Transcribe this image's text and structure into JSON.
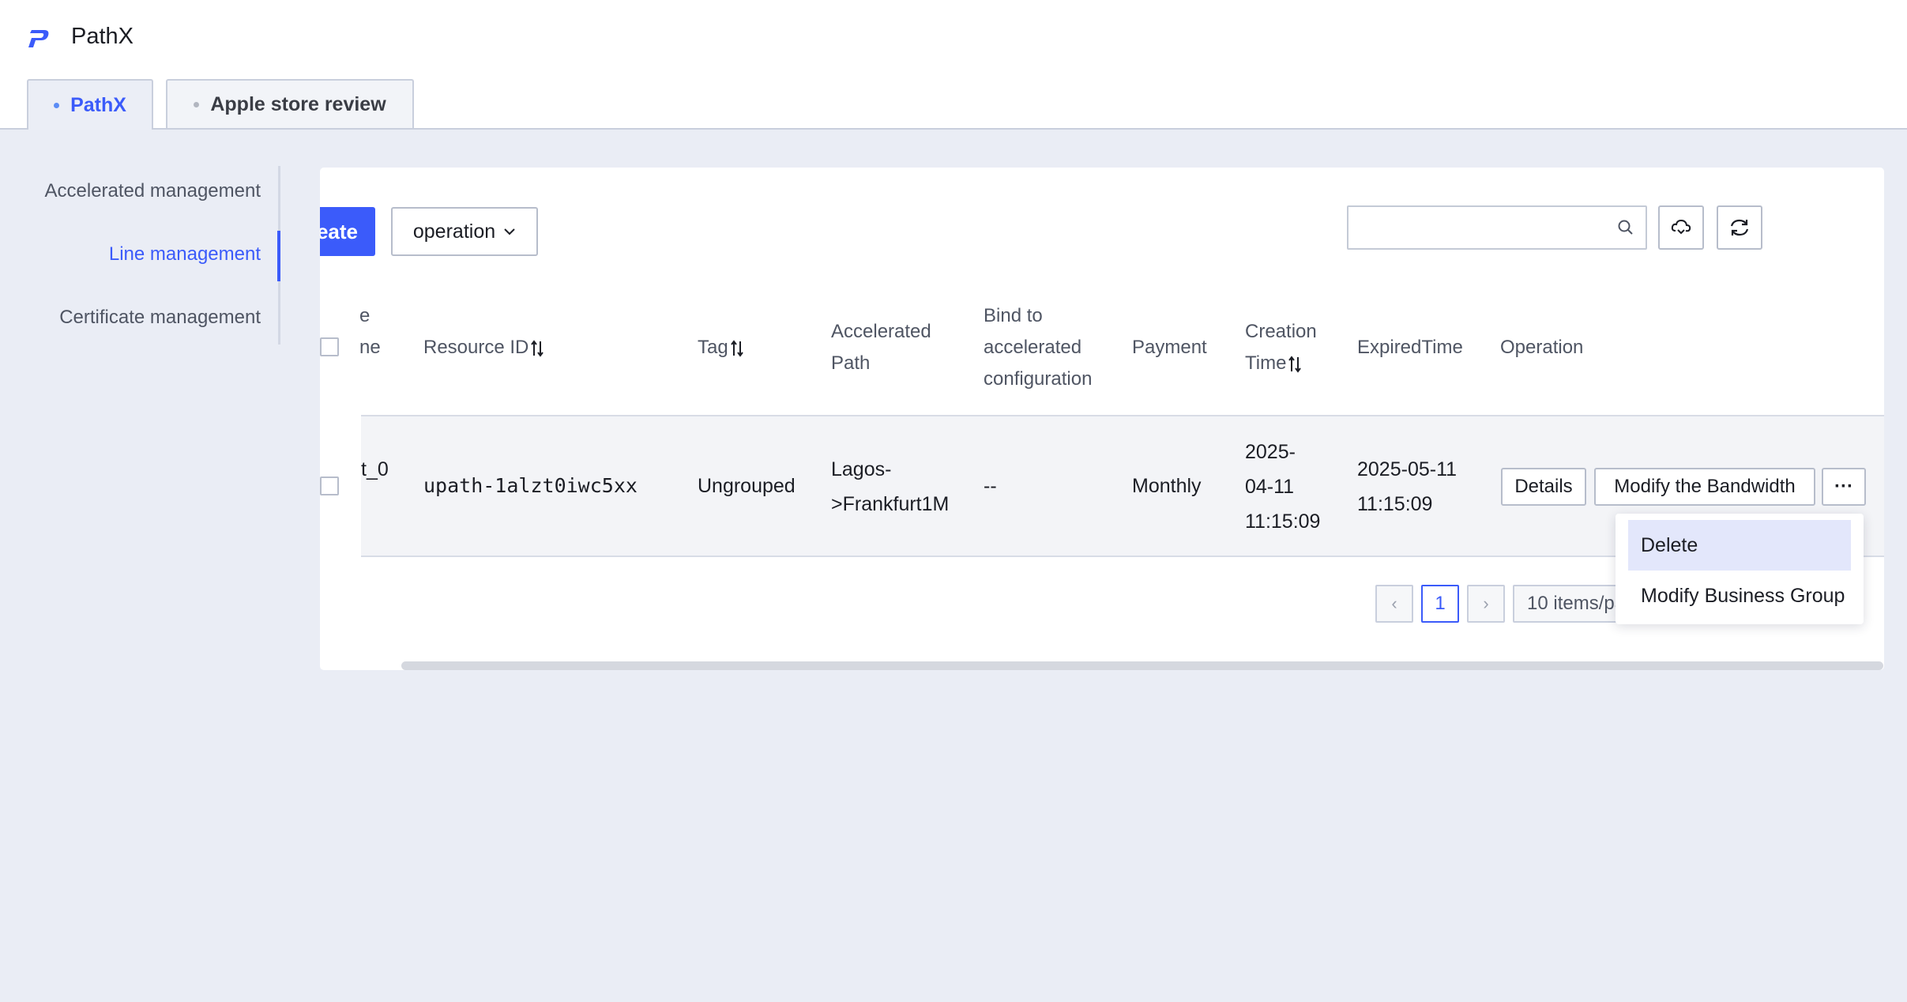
{
  "app": {
    "title": "PathX",
    "accent_color": "#3b5bfa",
    "logo_icon": "pathx-logo-icon"
  },
  "tabs": [
    {
      "label": "PathX",
      "active": true
    },
    {
      "label": "Apple store review",
      "active": false
    }
  ],
  "sidebar": {
    "items": [
      {
        "label": "Accelerated management",
        "active": false
      },
      {
        "label": "Line management",
        "active": true
      },
      {
        "label": "Certificate management",
        "active": false
      }
    ]
  },
  "toolbar": {
    "create_label": "eate",
    "operation_label": "operation",
    "search_placeholder": "",
    "search_icon": "search-icon",
    "cloud_icon": "cloud-icon",
    "refresh_icon": "refresh-icon"
  },
  "table": {
    "headers": {
      "name_line1": "e",
      "name_line2": "ne",
      "resource_id": "Resource ID",
      "tag": "Tag",
      "accel_path_line1": "Accelerated",
      "accel_path_line2": "Path",
      "bind_line1": "Bind to",
      "bind_line2": "accelerated",
      "bind_line3": "configuration",
      "payment": "Payment",
      "creation_line1": "Creation",
      "creation_line2": "Time",
      "expired": "ExpiredTime",
      "operation": "Operation"
    },
    "rows": [
      {
        "name": "t_0",
        "resource_id": "upath-1alzt0iwc5xx",
        "tag": "Ungrouped",
        "accel_path_line1": "Lagos-",
        "accel_path_line2": ">Frankfurt1M",
        "bind": "--",
        "payment": "Monthly",
        "creation_line1": "2025-",
        "creation_line2": "04-11",
        "creation_line3": "11:15:09",
        "expired_line1": "2025-05-11",
        "expired_line2": "11:15:09",
        "details_label": "Details",
        "modify_bw_label": "Modify the Bandwidth",
        "more_label": "···"
      }
    ]
  },
  "pagination": {
    "prev": "‹",
    "current_page": "1",
    "next": "›",
    "per_page": "10 items/page"
  },
  "dropdown": {
    "items": [
      {
        "label": "Delete"
      },
      {
        "label": "Modify Business Group"
      }
    ]
  }
}
